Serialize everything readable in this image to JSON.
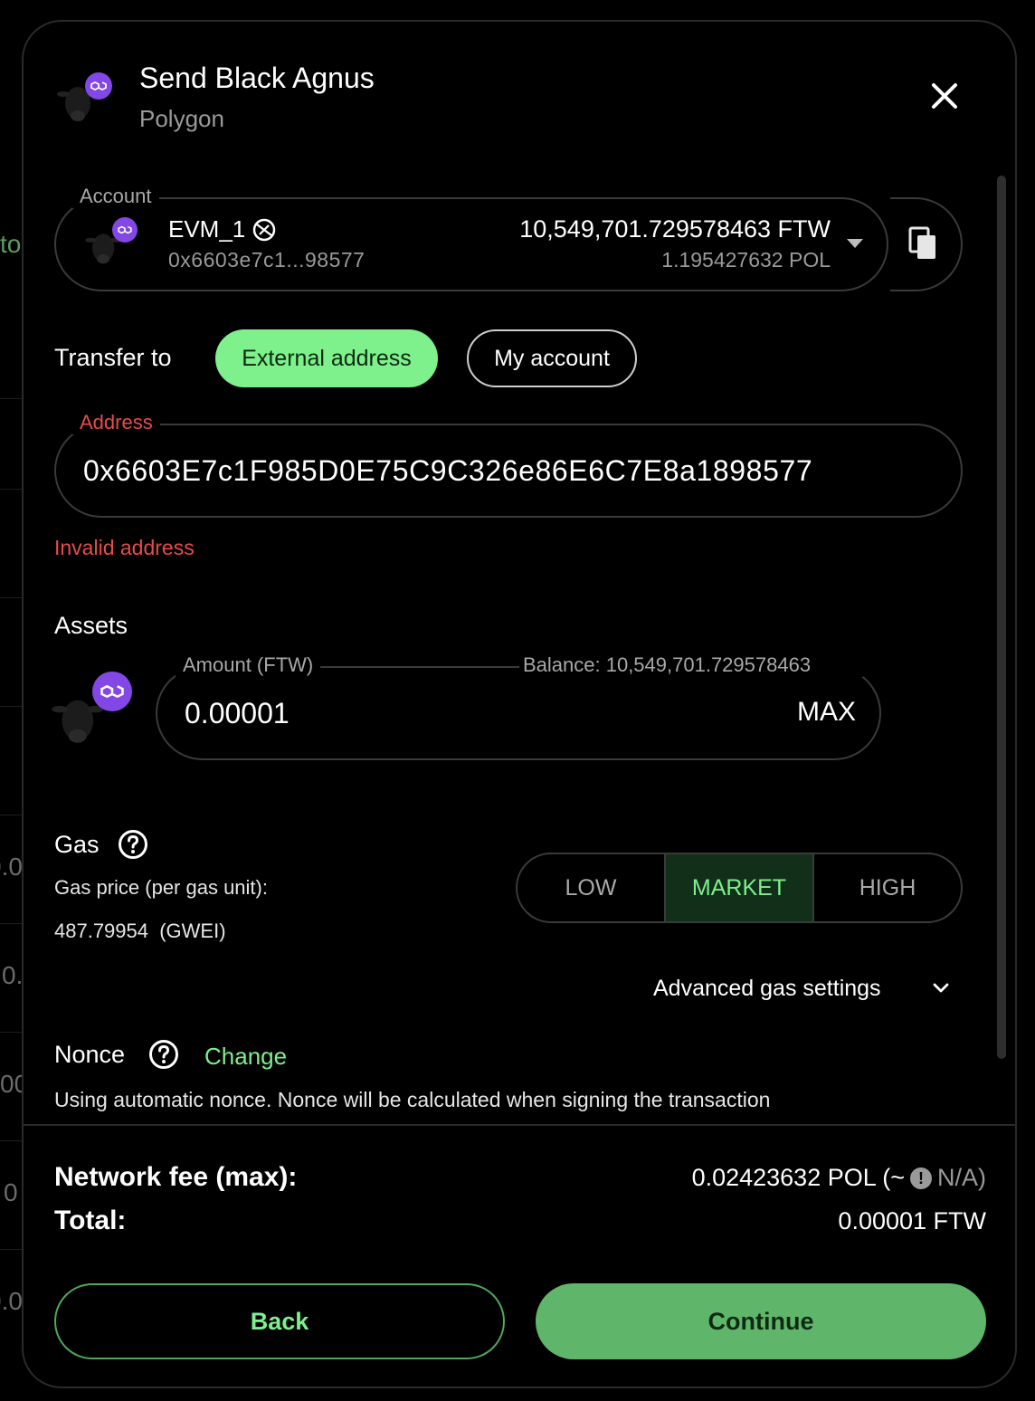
{
  "background": {
    "fragments": [
      "to",
      "0.0",
      "0.",
      "00",
      "0",
      "0.0",
      ".0"
    ]
  },
  "header": {
    "title": "Send Black Agnus",
    "subtitle": "Polygon"
  },
  "account": {
    "legend": "Account",
    "name": "EVM_1",
    "address": "0x6603e7c1...98577",
    "balance_primary": "10,549,701.729578463 FTW",
    "balance_secondary": "1.195427632 POL"
  },
  "transfer": {
    "label": "Transfer to",
    "options": [
      "External address",
      "My account"
    ],
    "selected": "External address"
  },
  "address": {
    "legend": "Address",
    "value": "0x6603E7c1F985D0E75C9C326e86E6C7E8a1898577",
    "error": "Invalid address"
  },
  "assets": {
    "label": "Assets",
    "amount_legend": "Amount (FTW)",
    "balance_legend": "Balance: 10,549,701.729578463",
    "amount_value": "0.00001",
    "max_label": "MAX"
  },
  "gas": {
    "label": "Gas",
    "price_label": "Gas price (per gas unit):",
    "price_value": "487.79954  (GWEI)",
    "options": [
      "LOW",
      "MARKET",
      "HIGH"
    ],
    "selected": "MARKET",
    "advanced_label": "Advanced gas settings"
  },
  "nonce": {
    "label": "Nonce",
    "change_label": "Change",
    "description": "Using automatic nonce. Nonce will be calculated when signing the transaction"
  },
  "summary": {
    "fee_label": "Network fee (max):",
    "fee_value": "0.02423632 POL (~",
    "fee_fiat": "N/A)",
    "total_label": "Total:",
    "total_value": "0.00001 FTW"
  },
  "actions": {
    "back": "Back",
    "continue": "Continue"
  },
  "colors": {
    "accent": "#7ef08c",
    "error": "#e84b4b",
    "polygon": "#8247e5",
    "continue_bg": "#5fb66b"
  }
}
